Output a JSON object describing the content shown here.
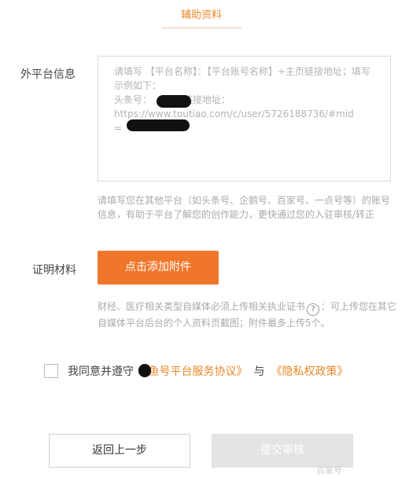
{
  "tab": {
    "label": "辅助资料"
  },
  "platform_info": {
    "label": "外平台信息",
    "placeholder": "请填写 【平台名称】：【平台账号名称】+主页链接地址；填写示例如下：\n头条号：        ，主页链接地址：\nhttps://www.toutiao.com/c/user/5726188736/#mid\n=",
    "hint": "请填写您在其他平台（如头条号、企鹅号、百家号、一点号等）的账号信息，有助于平台了解您的创作能力，更快通过您的入驻审核/转正"
  },
  "proof": {
    "label": "证明材料",
    "attach_button": "点击添加附件",
    "hint_before": "财经、医疗相关类型自媒体必须上传相关执业证书",
    "help_icon": "?",
    "hint_after": "：可上传您在其它自媒体平台后台的个人资料页截图；附件最多上传5个。"
  },
  "agreement": {
    "prefix": "我同意并遵守",
    "link1": "《  鱼号平台服务协议》",
    "joiner": "与",
    "link2": "《隐私权政策》"
  },
  "actions": {
    "back": "返回上一步",
    "submit": "提交审核"
  },
  "watermark": "百家号·",
  "colors": {
    "accent": "#f0772a",
    "link": "#e8892a",
    "disabled": "#e4e4e4"
  }
}
